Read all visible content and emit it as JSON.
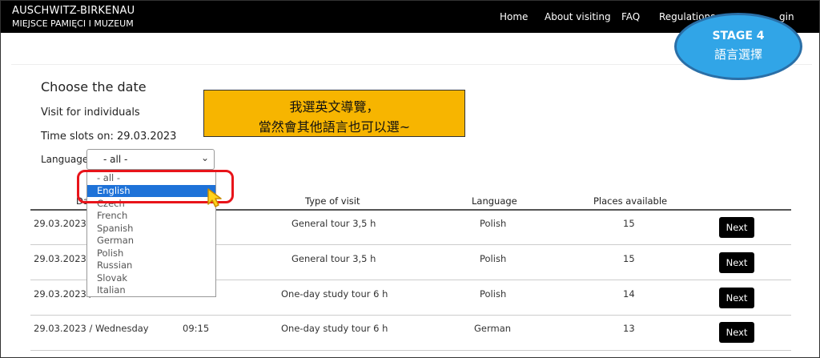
{
  "header": {
    "logo_line1": "AUSCHWITZ-BIRKENAU",
    "logo_line2": "MIEJSCE PAMIĘCI I MUZEUM",
    "nav": [
      "Home",
      "About visiting",
      "FAQ",
      "Regulations",
      "gin"
    ]
  },
  "page": {
    "title": "Choose the date",
    "visit_type": "Visit for individuals",
    "time_slots": "Time slots on: 29.03.2023",
    "language_label": "Language:",
    "language_selected": "- all -"
  },
  "dropdown": {
    "options": [
      "- all -",
      "English",
      "Czech",
      "French",
      "Spanish",
      "German",
      "Polish",
      "Russian",
      "Slovak",
      "Italian"
    ],
    "highlighted": "English"
  },
  "table": {
    "columns": [
      "Da",
      "Type of visit",
      "Language",
      "Places available"
    ],
    "rows": [
      {
        "date": "29.03.2023 /",
        "time": "",
        "type": "General tour 3,5 h",
        "language": "Polish",
        "places": "15",
        "action": "Next"
      },
      {
        "date": "29.03.2023 /",
        "time": "",
        "type": "General tour 3,5 h",
        "language": "Polish",
        "places": "15",
        "action": "Next"
      },
      {
        "date": "29.03.2023 /",
        "time": "",
        "type": "One-day study tour 6 h",
        "language": "Polish",
        "places": "14",
        "action": "Next"
      },
      {
        "date": "29.03.2023 / Wednesday",
        "time": "09:15",
        "type": "One-day study tour 6 h",
        "language": "German",
        "places": "13",
        "action": "Next"
      }
    ]
  },
  "annotation": {
    "callout_line1": "我選英文導覽，",
    "callout_line2": "當然會其他語言也可以選~",
    "stage_line1": "STAGE 4",
    "stage_line2": "語言選擇"
  },
  "colors": {
    "header_bg": "#000000",
    "highlight": "#1e72d8",
    "callout_bg": "#f7b500",
    "stage_bg": "#31a5e7",
    "red_box": "#e8141a"
  }
}
